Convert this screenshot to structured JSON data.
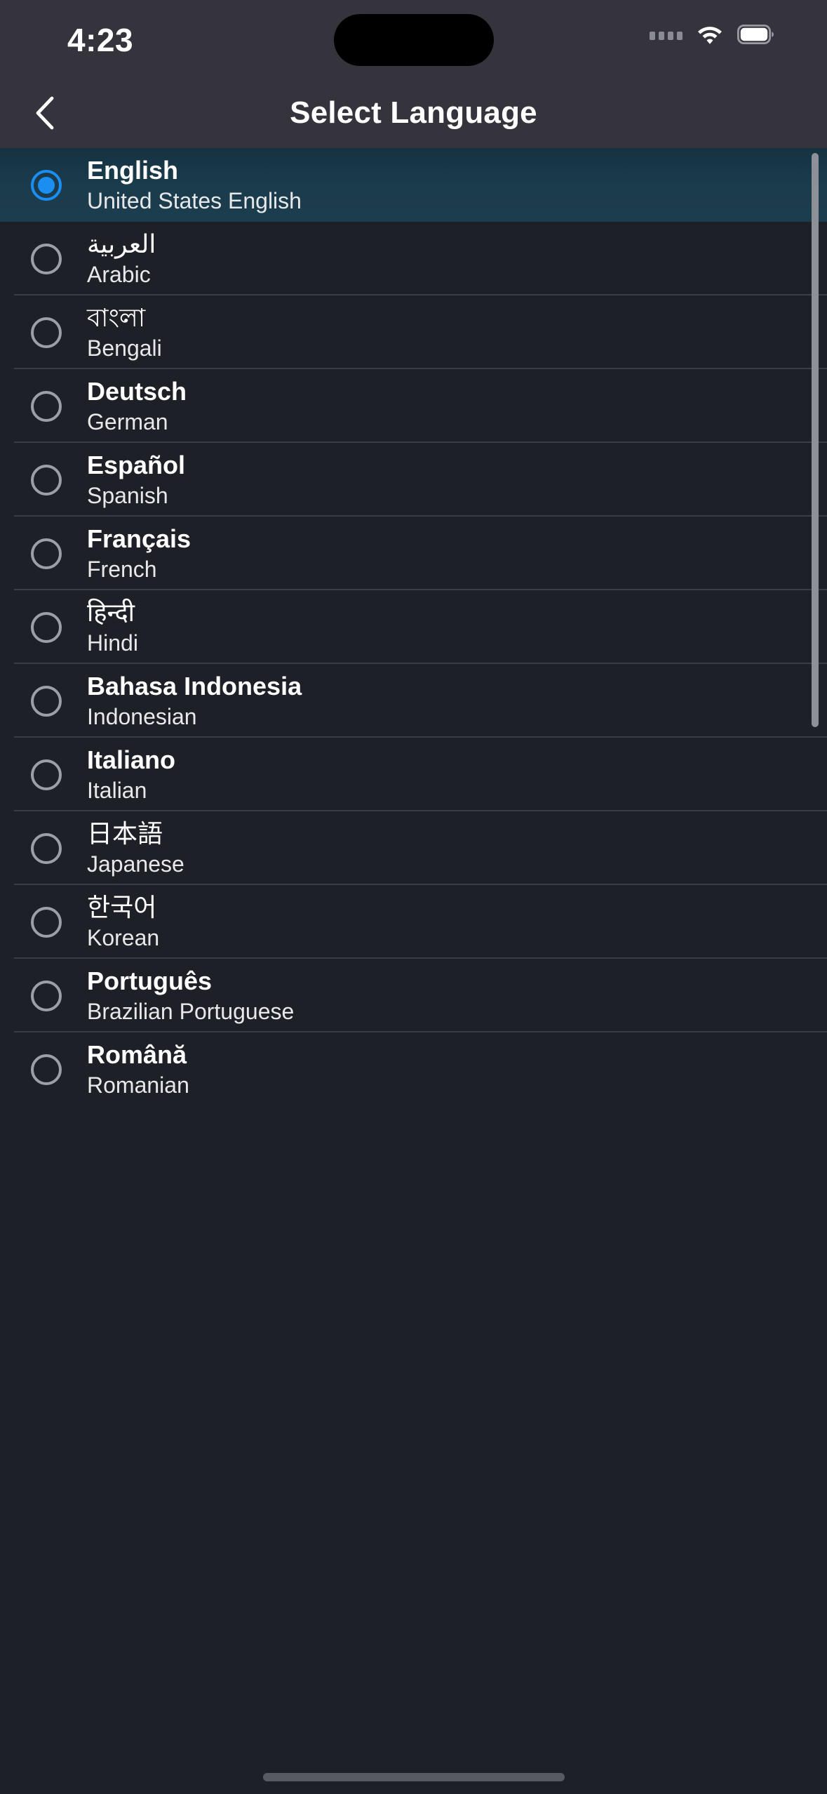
{
  "status_bar": {
    "time": "4:23",
    "icons": {
      "signal": "signal-dots-icon",
      "wifi": "wifi-icon",
      "battery": "battery-full-icon"
    }
  },
  "nav_bar": {
    "back_icon": "chevron-left-icon",
    "title": "Select Language"
  },
  "colors": {
    "header_bg": "#35343d",
    "list_bg": "#1e2027",
    "selected_row_bg": "#1b3c4c",
    "accent": "#1b8ef2",
    "radio_unselected": "#9aa0a6",
    "divider": "#3a3d44",
    "text_primary": "#ffffff",
    "text_secondary": "#e6e8ea",
    "scrollbar": "#8d9197"
  },
  "languages": [
    {
      "native": "English",
      "english": "United States English",
      "selected": true,
      "script": false
    },
    {
      "native": "العربية",
      "english": "Arabic",
      "selected": false,
      "script": true
    },
    {
      "native": "বাংলা",
      "english": "Bengali",
      "selected": false,
      "script": true
    },
    {
      "native": "Deutsch",
      "english": "German",
      "selected": false,
      "script": false
    },
    {
      "native": "Español",
      "english": "Spanish",
      "selected": false,
      "script": false
    },
    {
      "native": "Français",
      "english": "French",
      "selected": false,
      "script": false
    },
    {
      "native": "हिन्दी",
      "english": "Hindi",
      "selected": false,
      "script": true
    },
    {
      "native": "Bahasa Indonesia",
      "english": "Indonesian",
      "selected": false,
      "script": false
    },
    {
      "native": "Italiano",
      "english": "Italian",
      "selected": false,
      "script": false
    },
    {
      "native": "日本語",
      "english": "Japanese",
      "selected": false,
      "script": true
    },
    {
      "native": "한국어",
      "english": "Korean",
      "selected": false,
      "script": true
    },
    {
      "native": "Português",
      "english": "Brazilian Portuguese",
      "selected": false,
      "script": false
    },
    {
      "native": "Română",
      "english": "Romanian",
      "selected": false,
      "script": false
    }
  ],
  "scrollbar": {
    "visible": true
  },
  "home_indicator": {
    "visible": true
  }
}
